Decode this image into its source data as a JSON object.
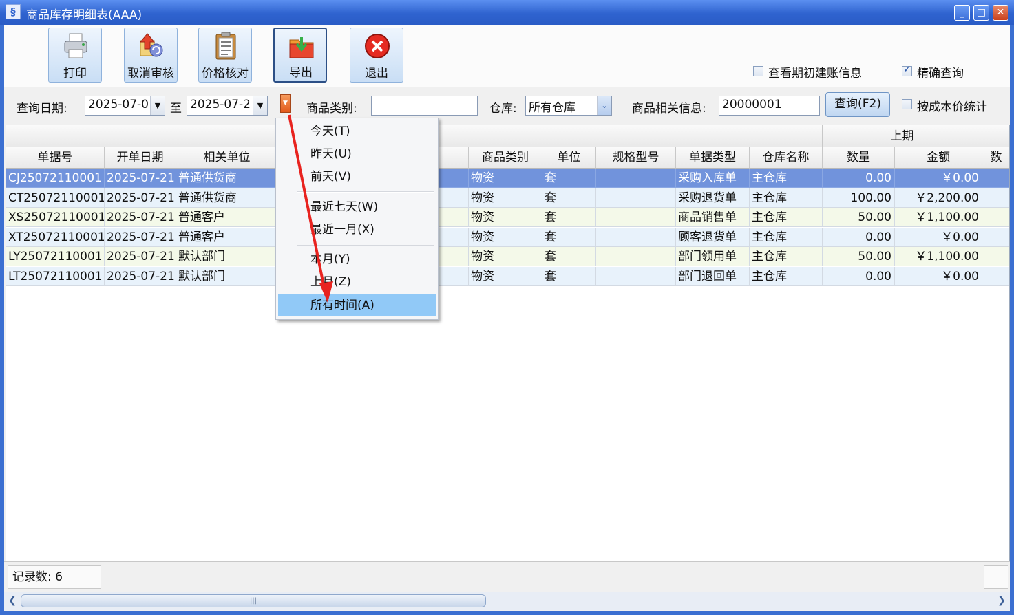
{
  "window": {
    "title": "商品库存明细表(AAA)",
    "controls": {
      "minimize": "_",
      "maximize": "□",
      "close": "✕"
    }
  },
  "toolbar": {
    "buttons": [
      {
        "label": "打印",
        "icon": "printer-icon"
      },
      {
        "label": "取消审核",
        "icon": "cancel-audit-icon"
      },
      {
        "label": "价格核对",
        "icon": "clipboard-icon"
      },
      {
        "label": "导出",
        "icon": "export-icon"
      },
      {
        "label": "退出",
        "icon": "exit-icon"
      }
    ],
    "options": [
      {
        "label": "查看期初建账信息",
        "checked": false
      },
      {
        "label": "精确查询",
        "checked": true
      }
    ]
  },
  "filter": {
    "date_label": "查询日期:",
    "date_from": "2025-07-0",
    "to_label": "至",
    "date_to": "2025-07-2",
    "category_label": "商品类别:",
    "category_value": "",
    "warehouse_label": "仓库:",
    "warehouse_value": "所有仓库",
    "info_label": "商品相关信息:",
    "info_value": "20000001",
    "query_button": "查询(F2)",
    "cost_stat_label": "按成本价统计",
    "cost_stat_checked": false
  },
  "grid": {
    "group_header": "上期",
    "columns": [
      "单据号",
      "开单日期",
      "相关单位",
      "商品类别",
      "单位",
      "规格型号",
      "单据类型",
      "仓库名称",
      "数量",
      "金额",
      "数"
    ],
    "rows": [
      [
        "CJ25072110001",
        "2025-07-21",
        "普通供货商",
        "物资",
        "套",
        "",
        "采购入库单",
        "主仓库",
        "0.00",
        "￥0.00"
      ],
      [
        "CT25072110001",
        "2025-07-21",
        "普通供货商",
        "物资",
        "套",
        "",
        "采购退货单",
        "主仓库",
        "100.00",
        "￥2,200.00"
      ],
      [
        "XS25072110001",
        "2025-07-21",
        "普通客户",
        "物资",
        "套",
        "",
        "商品销售单",
        "主仓库",
        "50.00",
        "￥1,100.00"
      ],
      [
        "XT25072110001",
        "2025-07-21",
        "普通客户",
        "物资",
        "套",
        "",
        "顾客退货单",
        "主仓库",
        "0.00",
        "￥0.00"
      ],
      [
        "LY25072110001",
        "2025-07-21",
        "默认部门",
        "物资",
        "套",
        "",
        "部门领用单",
        "主仓库",
        "50.00",
        "￥1,100.00"
      ],
      [
        "LT25072110001",
        "2025-07-21",
        "默认部门",
        "物资",
        "套",
        "",
        "部门退回单",
        "主仓库",
        "0.00",
        "￥0.00"
      ]
    ],
    "selected_row": 0
  },
  "menu": {
    "items": [
      "今天(T)",
      "昨天(U)",
      "前天(V)",
      "最近七天(W)",
      "最近一月(X)",
      "本月(Y)",
      "上月(Z)",
      "所有时间(A)"
    ],
    "highlighted": 7
  },
  "status": {
    "record_label": "记录数:",
    "record_count": "6"
  },
  "colors": {
    "title_bar": "#2f63cf",
    "selected_row": "#7193dc",
    "menu_highlight": "#91c9f7",
    "arrow": "#e8231f"
  }
}
